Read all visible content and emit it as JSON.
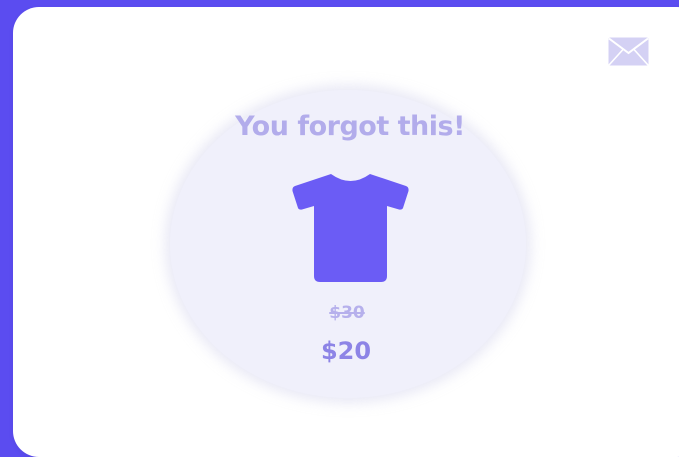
{
  "popup": {
    "title": "You forgot this!",
    "old_price": "$30",
    "new_price": "$20"
  },
  "icons": {
    "mail": "envelope-icon",
    "product": "tshirt-icon"
  },
  "colors": {
    "background": "#5b4cf0",
    "card": "#ffffff",
    "circle": "#f0f0fb",
    "title": "#b2aceb",
    "shirt": "#6b5cf5",
    "price": "#8d84e6"
  }
}
